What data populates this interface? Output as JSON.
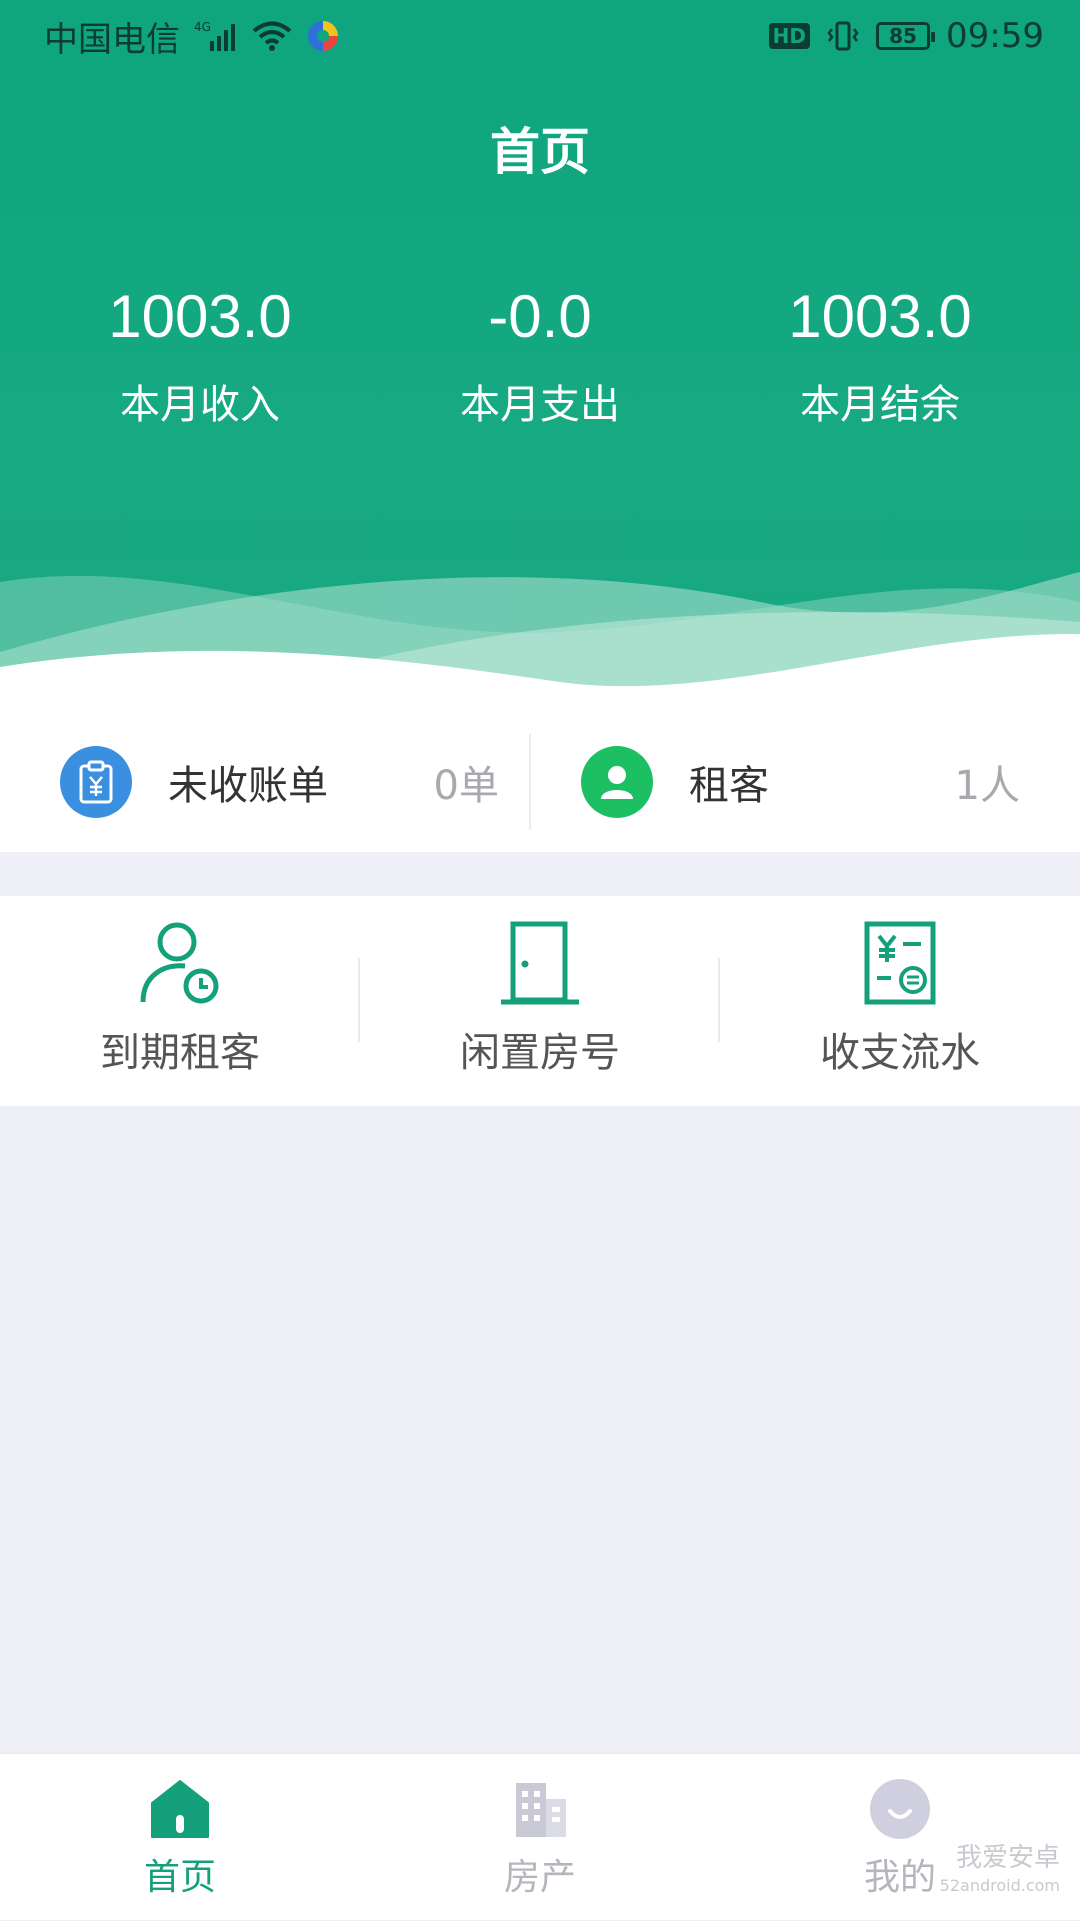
{
  "status_bar": {
    "carrier": "中国电信",
    "network": "4G",
    "battery": "85",
    "time": "09:59",
    "hd_label": "HD"
  },
  "header": {
    "title": "首页",
    "stats": [
      {
        "value": "1003.0",
        "label": "本月收入"
      },
      {
        "value": "-0.0",
        "label": "本月支出"
      },
      {
        "value": "1003.0",
        "label": "本月结余"
      }
    ]
  },
  "summary": {
    "unpaid_bills": {
      "label": "未收账单",
      "count": "0单",
      "icon": "bill-clipboard-icon"
    },
    "tenants": {
      "label": "租客",
      "count": "1人",
      "icon": "person-icon"
    }
  },
  "actions": [
    {
      "label": "到期租客",
      "icon": "tenant-clock-icon"
    },
    {
      "label": "闲置房号",
      "icon": "door-icon"
    },
    {
      "label": "收支流水",
      "icon": "ledger-icon"
    }
  ],
  "bottom_nav": [
    {
      "label": "首页",
      "icon": "home-icon",
      "active": true
    },
    {
      "label": "房产",
      "icon": "building-icon",
      "active": false
    },
    {
      "label": "我的",
      "icon": "profile-icon",
      "active": false
    }
  ],
  "watermark": {
    "text": "我爱安卓",
    "sub": "52android.com"
  },
  "colors": {
    "primary": "#0fa57f",
    "accent_text": "#13a07a",
    "blue_icon": "#3a8fe0",
    "green_icon": "#1dbf63",
    "background": "#efeff7"
  }
}
